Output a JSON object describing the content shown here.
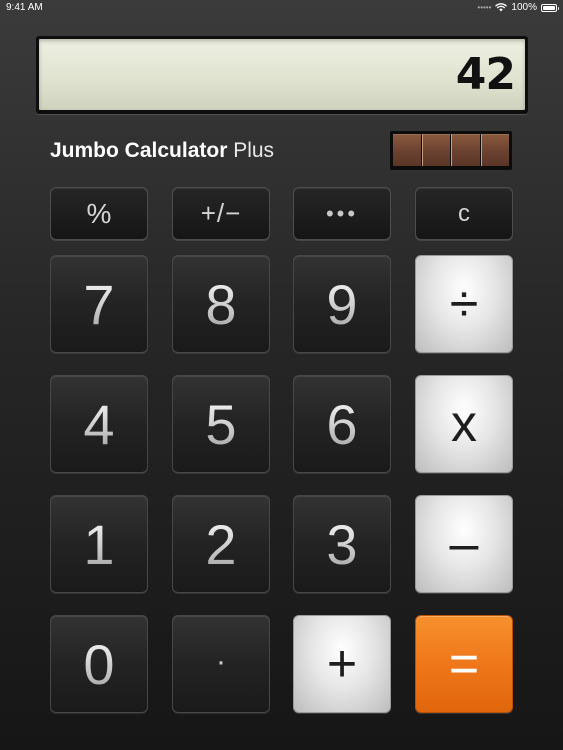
{
  "status_bar": {
    "time": "9:41 AM",
    "battery": "100%"
  },
  "display": {
    "value": "42"
  },
  "brand": {
    "name": "Jumbo Calculator",
    "suffix": " Plus"
  },
  "keys": {
    "percent": "%",
    "plus_minus": "+/−",
    "more": "•••",
    "clear": "c",
    "seven": "7",
    "eight": "8",
    "nine": "9",
    "divide": "÷",
    "four": "4",
    "five": "5",
    "six": "6",
    "multiply": "x",
    "one": "1",
    "two": "2",
    "three": "3",
    "minus": "–",
    "zero": "0",
    "decimal": "·",
    "plus": "+",
    "equals": "="
  },
  "icons": {
    "wifi": "wifi-icon",
    "battery": "battery-icon",
    "signal_dots": "signal-dots-icon"
  },
  "colors": {
    "equals_accent": "#f07a1c",
    "operator_key": "#e0e0e0",
    "display_bg": "#dfe2cf"
  }
}
